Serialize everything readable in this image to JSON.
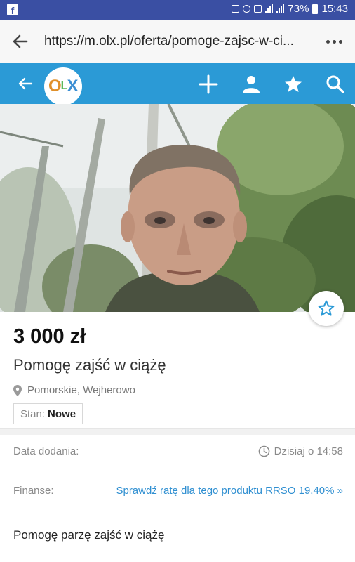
{
  "status_bar": {
    "battery": "73%",
    "time": "15:43"
  },
  "browser": {
    "url": "https://m.olx.pl/oferta/pomoge-zajsc-w-ci..."
  },
  "app": {
    "logo": "OLX",
    "brand_color": "#2b9ad6"
  },
  "listing": {
    "price": "3 000 zł",
    "title": "Pomogę zajść w ciążę",
    "location": "Pomorskie, Wejherowo",
    "condition_label": "Stan:",
    "condition_value": "Nowe",
    "date_label": "Data dodania:",
    "date_value": "Dzisiaj o 14:58",
    "finance_label": "Finanse:",
    "finance_link": "Sprawdź ratę dla tego produktu RRSO 19,40% »",
    "description": "Pomogę parzę zajść w ciążę"
  },
  "icons": {
    "back": "arrow-left-icon",
    "add": "plus-icon",
    "account": "user-icon",
    "favorites": "star-icon",
    "search": "search-icon",
    "location": "map-pin-icon",
    "clock": "clock-icon"
  }
}
